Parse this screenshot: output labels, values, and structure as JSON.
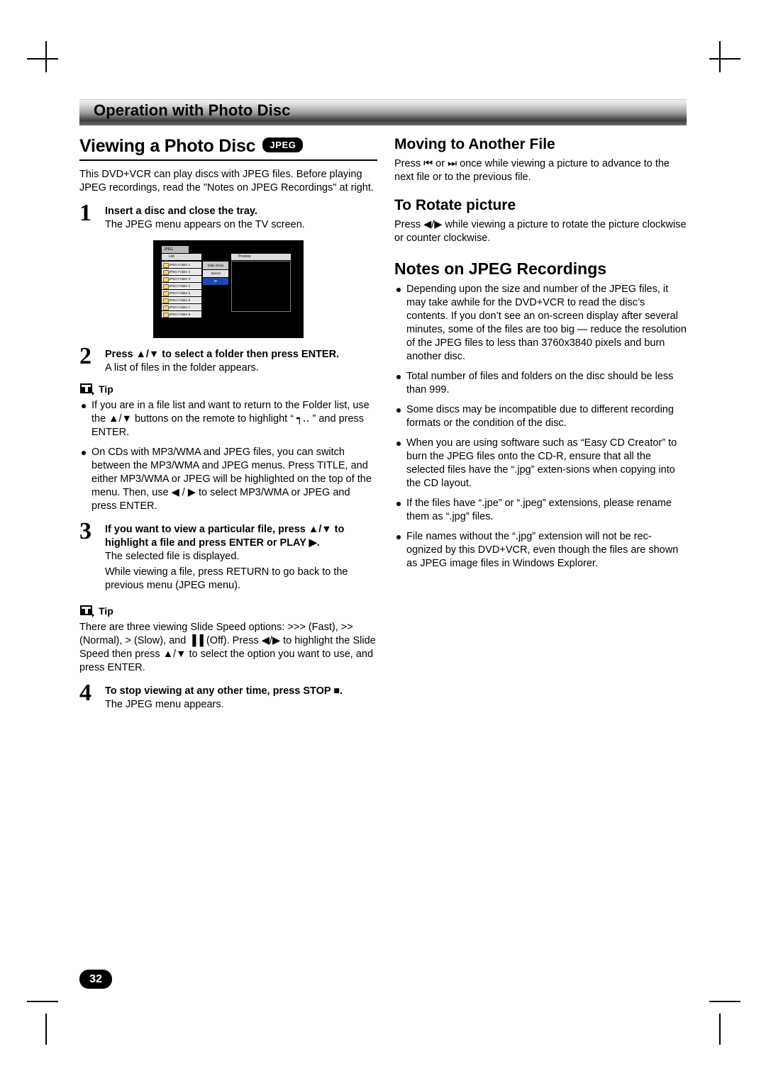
{
  "header": {
    "banner_title": "Operation with Photo Disc"
  },
  "left": {
    "section_title": "Viewing a Photo Disc",
    "jpeg_badge": "JPEG",
    "intro": "This DVD+VCR can play discs with JPEG files. Before playing JPEG recordings, read the \"Notes on JPEG Recordings\" at right.",
    "steps": [
      {
        "num": "1",
        "title": "Insert a disc and close the tray.",
        "body": "The JPEG menu appears on the TV screen."
      },
      {
        "num": "2",
        "title": "Press ▲/▼ to select a folder then press ENTER.",
        "body": "A list of files in the folder appears."
      },
      {
        "num": "3",
        "title": "If you want to view a particular file, press ▲/▼ to highlight a file and press ENTER or PLAY ▶.",
        "body": "The selected file is displayed.",
        "body2": "While viewing a file, press RETURN to go back to the previous menu (JPEG menu)."
      },
      {
        "num": "4",
        "title": "To stop viewing at any other time, press STOP ■.",
        "body": "The JPEG menu appears."
      }
    ],
    "tip1": {
      "label": "Tip",
      "items": [
        "If you are in a file list and want to return to the Folder list, use the ▲/▼ buttons on the remote to highlight “ ┑‥ ” and press ENTER.",
        "On CDs with MP3/WMA and JPEG files, you can switch between the MP3/WMA and JPEG menus. Press TITLE, and either MP3/WMA or JPEG will be highlighted on the top of the menu. Then, use ◀ / ▶ to select MP3/WMA or JPEG and press ENTER."
      ]
    },
    "tip2": {
      "label": "Tip",
      "text": "There are three viewing Slide Speed options: >>> (Fast), >> (Normal), > (Slow), and ▐▐ (Off). Press ◀/▶ to highlight the Slide Speed then press ▲/▼ to select the option you want to use, and press ENTER."
    },
    "screen": {
      "tab_label": "JPEG",
      "list_header": "List",
      "preview_header": "Preview",
      "slide_show_label": "Slide Show",
      "speed_label": "Speed",
      "speed_value": "≫",
      "folders": [
        "JPEG Folder 1",
        "JPEG Folder 2",
        "JPEG Folder 3",
        "JPEG Folder 4",
        "JPEG Folder 5",
        "JPEG Folder 6",
        "JPEG Folder 7",
        "JPEG Folder 8"
      ]
    }
  },
  "right": {
    "moving_title": "Moving to Another File",
    "moving_body": "Press ⏮ or ⏭ once while viewing a picture to advance to the next file or to the previous file.",
    "rotate_title": "To Rotate picture",
    "rotate_body": "Press ◀/▶ while viewing a picture to rotate the picture clockwise or counter clockwise.",
    "notes_title": "Notes on JPEG Recordings",
    "notes": [
      "Depending upon the size and number of the JPEG files, it may take awhile for the DVD+VCR to read the disc’s contents. If you don’t see an on-screen display after several minutes, some of the files are too big — reduce the resolution of the JPEG files to less than 3760x3840 pixels and burn another disc.",
      "Total number of files and folders on the disc should be less than 999.",
      "Some discs may be incompatible due to different recording formats or the condition of the disc.",
      "When you are using software such as “Easy CD Creator” to burn the JPEG files onto the CD-R, ensure that all the selected files have the “.jpg” exten-sions when copying into the CD layout.",
      "If the files have “.jpe” or “.jpeg” extensions, please rename them as “.jpg” files.",
      "File names without the “.jpg” extension will not be rec-ognized by this DVD+VCR, even though the files are shown as JPEG image files in Windows Explorer."
    ]
  },
  "footer": {
    "page_number": "32"
  }
}
